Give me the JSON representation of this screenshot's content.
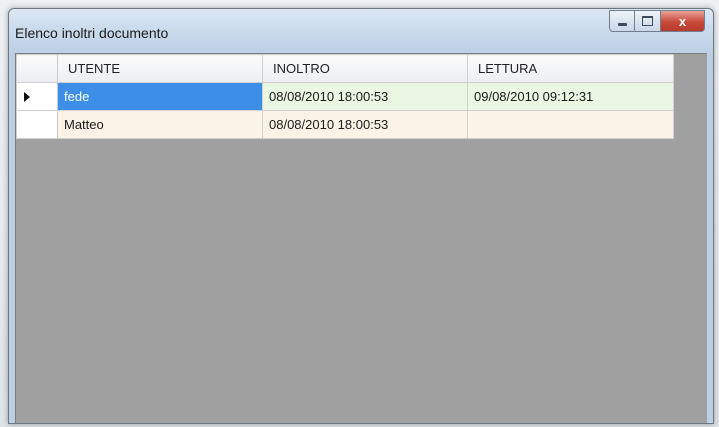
{
  "window": {
    "title": "Elenco inoltri documento",
    "controls": {
      "minimize_icon": "minimize-icon",
      "maximize_icon": "maximize-icon",
      "close_label": "x"
    }
  },
  "grid": {
    "columns": [
      "UTENTE",
      "INOLTRO",
      "LETTURA"
    ],
    "rows": [
      {
        "utente": "fede",
        "inoltro": "08/08/2010 18:00:53",
        "lettura": "09/08/2010 09:12:31",
        "current": true
      },
      {
        "utente": "Matteo",
        "inoltro": "08/08/2010 18:00:53",
        "lettura": "",
        "current": false
      }
    ],
    "colors": {
      "selected_cell": "#3d8ee6",
      "row_even": "#e9f7e3",
      "row_odd": "#fbf3e6",
      "empty_area": "#a0a0a0"
    }
  }
}
